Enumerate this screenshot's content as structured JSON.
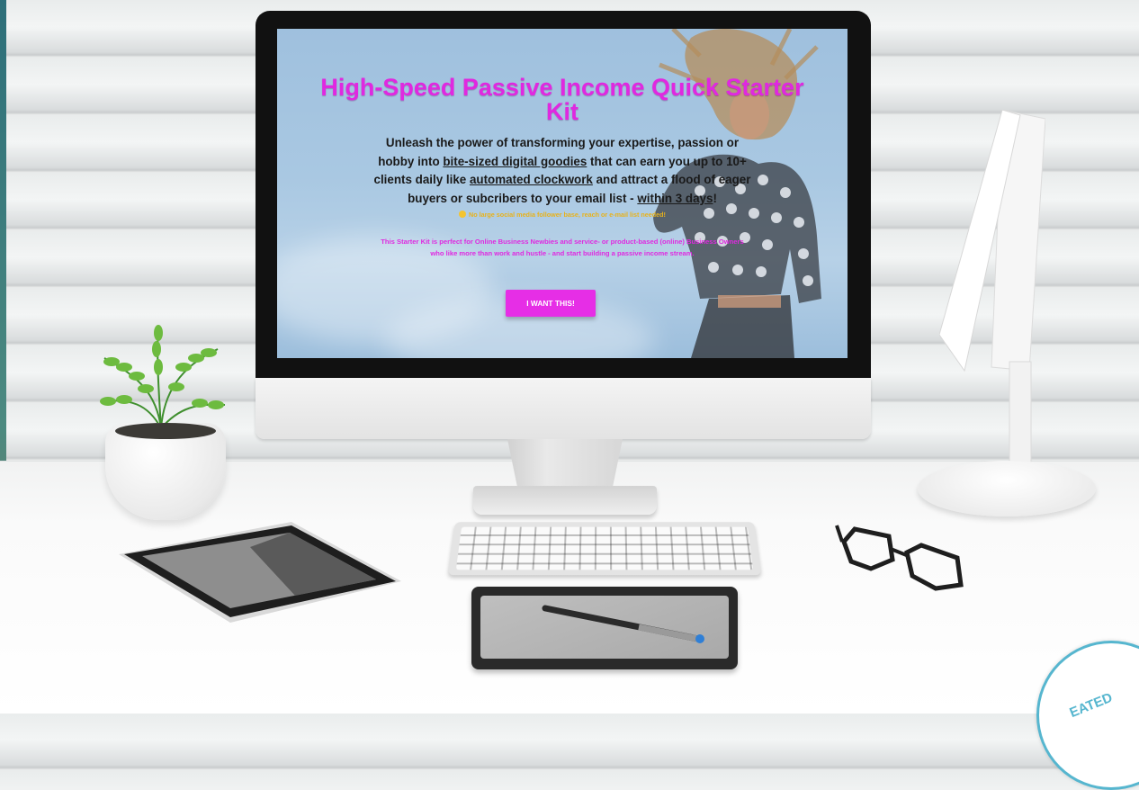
{
  "landing": {
    "title": "High-Speed Passive Income Quick Starter Kit",
    "subtitle_parts": {
      "p1": "Unleash the power of transforming your expertise, passion or hobby into ",
      "link1": "bite-sized digital goodies",
      "p2": " that can earn you up to 10+ clients daily like ",
      "link2": "automated clockwork",
      "p3": " and attract a flood of eager buyers or subcribers to your email list - ",
      "link3": "within 3 days",
      "p4": "!"
    },
    "note": "No large social media follower base, reach or e-mail list needed!",
    "description": "This Starter Kit is perfect for Online Business Newbies and service- or product-based (online) Business Owners who like more than work and hustle - and start building a passive income stream.",
    "cta_label": "I WANT THIS!"
  },
  "badge": {
    "text": "EATED"
  },
  "colors": {
    "title": "#e028e0",
    "cta_bg": "#e62ee6",
    "note": "#e8b21a",
    "badge_ring": "#56b6cf"
  }
}
